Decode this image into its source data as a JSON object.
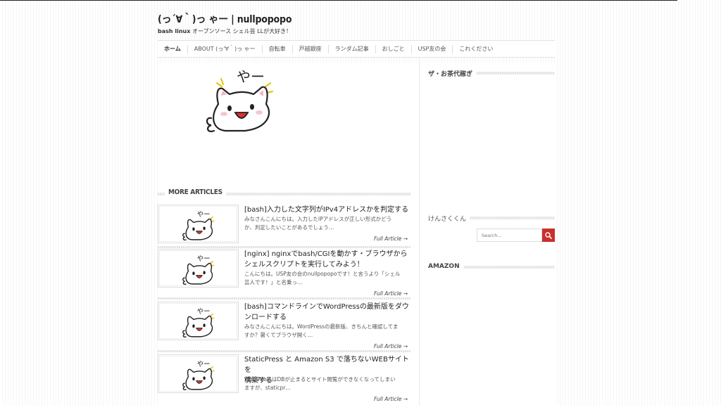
{
  "site": {
    "title": "(っ´∀｀)っ ゃー | nullpopopo",
    "description_bold": "bash linux",
    "description_rest": " オープンソース シェル芸 LLが大好き！"
  },
  "nav": {
    "items": [
      {
        "label": "ホーム"
      },
      {
        "label": "ABOUT (っ'∀｀)っ ゃー"
      },
      {
        "label": "自転車"
      },
      {
        "label": "戸越銀座"
      },
      {
        "label": "ランダム記事"
      },
      {
        "label": "おしごと"
      },
      {
        "label": "USP友の会"
      },
      {
        "label": "これください"
      }
    ]
  },
  "hero": {
    "speech": "やー"
  },
  "more_articles": {
    "heading": "MORE ARTICLES",
    "full_article_label": "Full Article →",
    "items": [
      {
        "title_line1": "[bash]入力した文字列がIPv4アドレスかを判定する",
        "title_line2": "",
        "excerpt_line1": "みなさんこんにちは。入力したIPアドレスが正しい形式かどう",
        "excerpt_line2": "か、判定したいことがあるでしょう…"
      },
      {
        "title_line1": "[nginx] nginxでbash/CGIを動かす・ブラウザから",
        "title_line2": "シェルスクリプトを実行してみよう！",
        "excerpt_line1": "こんにちは。USP友の会のnullpopopoです！と言うより「シェル",
        "excerpt_line2": "芸人です！」と名乗っ…"
      },
      {
        "title_line1": "[bash]コマンドラインでWordPressの最新版をダウ",
        "title_line2": "ンロードする",
        "excerpt_line1": "みなさんこんにちは。WordPressの最新版、きちんと確認してま",
        "excerpt_line2": "すか？暑くてブラウザ開く…"
      },
      {
        "title_line1": "StaticPress と Amazon S3 で落ちないWEBサイトを",
        "title_line2": "構築する",
        "excerpt_line1": "WordPressはDBが止まるとサイト閲覧ができなくなってしまい",
        "excerpt_line2": "ますが、staticpr…"
      }
    ]
  },
  "sidebar": {
    "widget1_title": "ザ・お茶代稼ぎ",
    "widget2_title": "けんさくくん",
    "search_placeholder": "Search...",
    "widget3_title": "AMAZON"
  },
  "colors": {
    "accent": "#c9302c",
    "text": "#333333"
  }
}
